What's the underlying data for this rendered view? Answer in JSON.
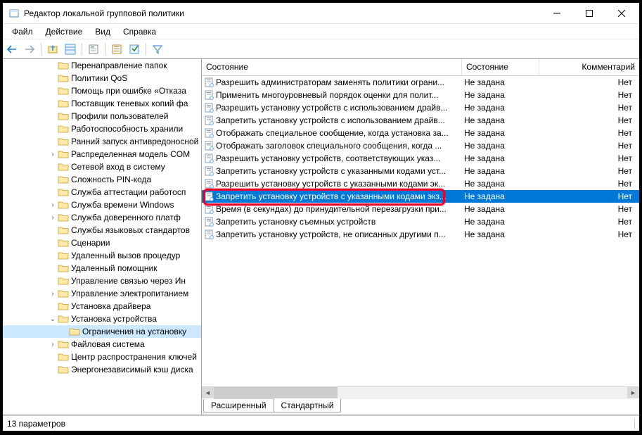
{
  "window": {
    "title": "Редактор локальной групповой политики"
  },
  "menu": {
    "file": "Файл",
    "action": "Действие",
    "view": "Вид",
    "help": "Справка"
  },
  "tree": [
    {
      "indent": 4,
      "label": "Перенаправление папок"
    },
    {
      "indent": 4,
      "label": "Политики QoS"
    },
    {
      "indent": 4,
      "label": "Помощь при ошибке «Отказа"
    },
    {
      "indent": 4,
      "label": "Поставщик теневых копий фа"
    },
    {
      "indent": 4,
      "label": "Профили пользователей"
    },
    {
      "indent": 4,
      "label": "Работоспособность хранили"
    },
    {
      "indent": 4,
      "label": "Ранний запуск антивредоносной"
    },
    {
      "indent": 4,
      "label": "Распределенная модель COM",
      "expander": "›"
    },
    {
      "indent": 4,
      "label": "Сетевой вход в систему"
    },
    {
      "indent": 4,
      "label": "Сложность PIN-кода"
    },
    {
      "indent": 4,
      "label": "Служба аттестации работосп"
    },
    {
      "indent": 4,
      "label": "Служба времени Windows",
      "expander": "›"
    },
    {
      "indent": 4,
      "label": "Служба доверенного платф",
      "expander": "›"
    },
    {
      "indent": 4,
      "label": "Службы языковых стандартов"
    },
    {
      "indent": 4,
      "label": "Сценарии"
    },
    {
      "indent": 4,
      "label": "Удаленный вызов процедур"
    },
    {
      "indent": 4,
      "label": "Удаленный помощник"
    },
    {
      "indent": 4,
      "label": "Управление связью через Ин"
    },
    {
      "indent": 4,
      "label": "Управление электропитанием",
      "expander": "›"
    },
    {
      "indent": 4,
      "label": "Установка драйвера"
    },
    {
      "indent": 4,
      "label": "Установка устройства",
      "expander": "⌄"
    },
    {
      "indent": 5,
      "label": "Ограничения на установку",
      "selected": true
    },
    {
      "indent": 4,
      "label": "Файловая система",
      "expander": "›"
    },
    {
      "indent": 4,
      "label": "Центр распространения ключей"
    },
    {
      "indent": 4,
      "label": "Энергонезависимый кэш диска"
    }
  ],
  "list": {
    "columns": {
      "state_header": "Состояние",
      "state": "Состояние",
      "comment": "Комментарий"
    },
    "rows": [
      {
        "name": "Разрешить администраторам заменять политики ограни...",
        "state": "Не задана",
        "comment": "Нет"
      },
      {
        "name": "Применить многоуровневый порядок оценки для полит...",
        "state": "Не задана",
        "comment": "Нет"
      },
      {
        "name": "Разрешить установку устройств с использованием драйв...",
        "state": "Не задана",
        "comment": "Нет"
      },
      {
        "name": "Запретить установку устройств с использованием драйв...",
        "state": "Не задана",
        "comment": "Нет"
      },
      {
        "name": "Отображать специальное сообщение, когда установка за...",
        "state": "Не задана",
        "comment": "Нет"
      },
      {
        "name": "Отображать заголовок специального сообщения, когда ...",
        "state": "Не задана",
        "comment": "Нет"
      },
      {
        "name": "Разрешить установку устройств, соответствующих указ...",
        "state": "Не задана",
        "comment": "Нет"
      },
      {
        "name": "Запретить установку устройств с указанными кодами уст...",
        "state": "Не задана",
        "comment": "Нет"
      },
      {
        "name": "Разрешить установку устройств с указанными кодами эк...",
        "state": "Не задана",
        "comment": "Нет"
      },
      {
        "name": "Запретить установку устройств с указанными кодами экз...",
        "state": "Не задана",
        "comment": "Нет",
        "selected": true
      },
      {
        "name": "Время (в секундах) до принудительной перезагрузки при...",
        "state": "Не задана",
        "comment": "Нет"
      },
      {
        "name": "Запретить установку съемных устройств",
        "state": "Не задана",
        "comment": "Нет"
      },
      {
        "name": "Запретить установку устройств, не описанных другими п...",
        "state": "Не задана",
        "comment": "Нет"
      }
    ]
  },
  "tabs": {
    "extended": "Расширенный",
    "standard": "Стандартный"
  },
  "status": {
    "text": "13 параметров"
  }
}
